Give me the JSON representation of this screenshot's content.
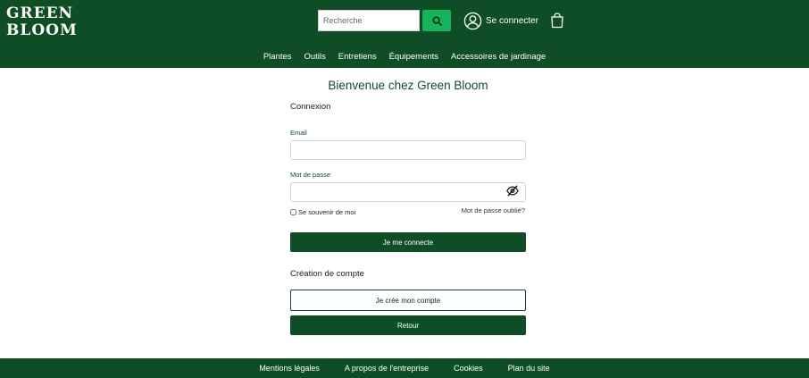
{
  "brand": {
    "line1": "GREEN",
    "line2": "BLOOM"
  },
  "header": {
    "search_placeholder": "Recherche",
    "login_label": "Se connecter"
  },
  "nav": {
    "items": [
      "Plantes",
      "Outils",
      "Entretiens",
      "Équipements",
      "Accessoires de jardinage"
    ]
  },
  "main": {
    "title": "Bienvenue chez Green Bloom",
    "login_section": "Connexion",
    "email_label": "Email",
    "password_label": "Mot de passe",
    "remember_label": "Se souvenir de moi",
    "forgot_label": "Mot de passe oublié?",
    "login_button": "Je me connecte",
    "signup_section": "Création de compte",
    "signup_button": "Je crée mon compte",
    "back_button": "Retour"
  },
  "footer": {
    "items": [
      "Mentions légales",
      "A propos de l'entreprise",
      "Cookies",
      "Plan du site"
    ]
  },
  "colors": {
    "brand_green": "#0f4d27",
    "accent_green": "#17b35a"
  },
  "icons": [
    "search-icon",
    "user-icon",
    "shopping-bag-icon",
    "eye-off-icon"
  ]
}
